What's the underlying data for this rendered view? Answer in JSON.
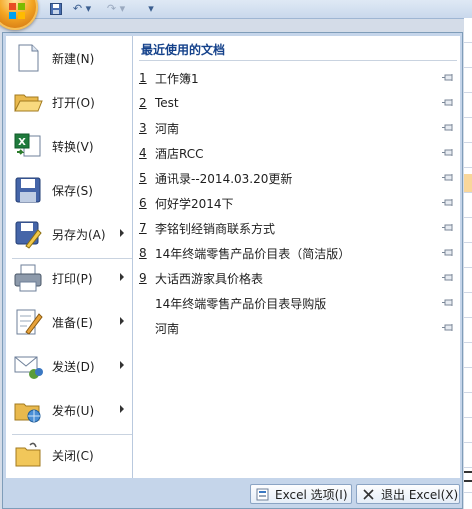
{
  "qat": {
    "undo_label": "↶ ▾",
    "redo_label": "↷ ▾",
    "customize_label": "▾"
  },
  "commands": [
    {
      "label": "新建(N)",
      "icon": "new-document-icon",
      "submenu": false
    },
    {
      "label": "打开(O)",
      "icon": "open-folder-icon",
      "submenu": false
    },
    {
      "label": "转换(V)",
      "icon": "convert-icon",
      "submenu": false
    },
    {
      "label": "保存(S)",
      "icon": "save-icon",
      "submenu": false
    },
    {
      "label": "另存为(A)",
      "icon": "save-as-icon",
      "submenu": true
    },
    {
      "label": "打印(P)",
      "icon": "print-icon",
      "submenu": true
    },
    {
      "label": "准备(E)",
      "icon": "prepare-icon",
      "submenu": true
    },
    {
      "label": "发送(D)",
      "icon": "send-icon",
      "submenu": true
    },
    {
      "label": "发布(U)",
      "icon": "publish-icon",
      "submenu": true
    },
    {
      "label": "关闭(C)",
      "icon": "close-folder-icon",
      "submenu": false
    }
  ],
  "recent": {
    "title": "最近使用的文档",
    "items": [
      {
        "num": "1",
        "name": "工作簿1"
      },
      {
        "num": "2",
        "name": "Test"
      },
      {
        "num": "3",
        "name": "河南"
      },
      {
        "num": "4",
        "name": "酒店RCC"
      },
      {
        "num": "5",
        "name": "通讯录--2014.03.20更新"
      },
      {
        "num": "6",
        "name": "何好学2014下"
      },
      {
        "num": "7",
        "name": "李铭钊经销商联系方式"
      },
      {
        "num": "8",
        "name": "14年终端零售产品价目表（简洁版）"
      },
      {
        "num": "9",
        "name": "大话西游家具价格表"
      },
      {
        "num": "",
        "name": "14年终端零售产品价目表导购版"
      },
      {
        "num": "",
        "name": "河南"
      }
    ]
  },
  "footer": {
    "options_label": "Excel 选项(I)",
    "exit_label": "退出 Excel(X)"
  }
}
